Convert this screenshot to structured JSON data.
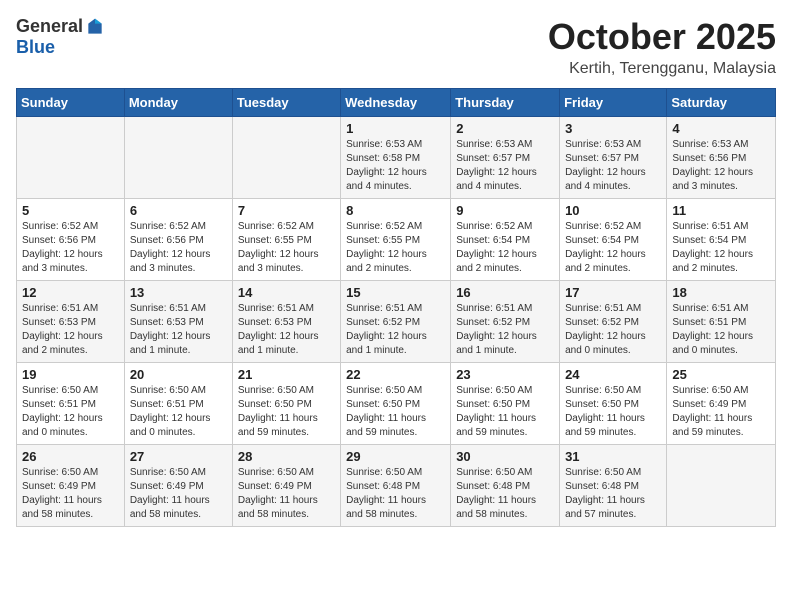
{
  "header": {
    "logo_general": "General",
    "logo_blue": "Blue",
    "month_title": "October 2025",
    "subtitle": "Kertih, Terengganu, Malaysia"
  },
  "days_of_week": [
    "Sunday",
    "Monday",
    "Tuesday",
    "Wednesday",
    "Thursday",
    "Friday",
    "Saturday"
  ],
  "weeks": [
    [
      {
        "day": "",
        "info": ""
      },
      {
        "day": "",
        "info": ""
      },
      {
        "day": "",
        "info": ""
      },
      {
        "day": "1",
        "info": "Sunrise: 6:53 AM\nSunset: 6:58 PM\nDaylight: 12 hours\nand 4 minutes."
      },
      {
        "day": "2",
        "info": "Sunrise: 6:53 AM\nSunset: 6:57 PM\nDaylight: 12 hours\nand 4 minutes."
      },
      {
        "day": "3",
        "info": "Sunrise: 6:53 AM\nSunset: 6:57 PM\nDaylight: 12 hours\nand 4 minutes."
      },
      {
        "day": "4",
        "info": "Sunrise: 6:53 AM\nSunset: 6:56 PM\nDaylight: 12 hours\nand 3 minutes."
      }
    ],
    [
      {
        "day": "5",
        "info": "Sunrise: 6:52 AM\nSunset: 6:56 PM\nDaylight: 12 hours\nand 3 minutes."
      },
      {
        "day": "6",
        "info": "Sunrise: 6:52 AM\nSunset: 6:56 PM\nDaylight: 12 hours\nand 3 minutes."
      },
      {
        "day": "7",
        "info": "Sunrise: 6:52 AM\nSunset: 6:55 PM\nDaylight: 12 hours\nand 3 minutes."
      },
      {
        "day": "8",
        "info": "Sunrise: 6:52 AM\nSunset: 6:55 PM\nDaylight: 12 hours\nand 2 minutes."
      },
      {
        "day": "9",
        "info": "Sunrise: 6:52 AM\nSunset: 6:54 PM\nDaylight: 12 hours\nand 2 minutes."
      },
      {
        "day": "10",
        "info": "Sunrise: 6:52 AM\nSunset: 6:54 PM\nDaylight: 12 hours\nand 2 minutes."
      },
      {
        "day": "11",
        "info": "Sunrise: 6:51 AM\nSunset: 6:54 PM\nDaylight: 12 hours\nand 2 minutes."
      }
    ],
    [
      {
        "day": "12",
        "info": "Sunrise: 6:51 AM\nSunset: 6:53 PM\nDaylight: 12 hours\nand 2 minutes."
      },
      {
        "day": "13",
        "info": "Sunrise: 6:51 AM\nSunset: 6:53 PM\nDaylight: 12 hours\nand 1 minute."
      },
      {
        "day": "14",
        "info": "Sunrise: 6:51 AM\nSunset: 6:53 PM\nDaylight: 12 hours\nand 1 minute."
      },
      {
        "day": "15",
        "info": "Sunrise: 6:51 AM\nSunset: 6:52 PM\nDaylight: 12 hours\nand 1 minute."
      },
      {
        "day": "16",
        "info": "Sunrise: 6:51 AM\nSunset: 6:52 PM\nDaylight: 12 hours\nand 1 minute."
      },
      {
        "day": "17",
        "info": "Sunrise: 6:51 AM\nSunset: 6:52 PM\nDaylight: 12 hours\nand 0 minutes."
      },
      {
        "day": "18",
        "info": "Sunrise: 6:51 AM\nSunset: 6:51 PM\nDaylight: 12 hours\nand 0 minutes."
      }
    ],
    [
      {
        "day": "19",
        "info": "Sunrise: 6:50 AM\nSunset: 6:51 PM\nDaylight: 12 hours\nand 0 minutes."
      },
      {
        "day": "20",
        "info": "Sunrise: 6:50 AM\nSunset: 6:51 PM\nDaylight: 12 hours\nand 0 minutes."
      },
      {
        "day": "21",
        "info": "Sunrise: 6:50 AM\nSunset: 6:50 PM\nDaylight: 11 hours\nand 59 minutes."
      },
      {
        "day": "22",
        "info": "Sunrise: 6:50 AM\nSunset: 6:50 PM\nDaylight: 11 hours\nand 59 minutes."
      },
      {
        "day": "23",
        "info": "Sunrise: 6:50 AM\nSunset: 6:50 PM\nDaylight: 11 hours\nand 59 minutes."
      },
      {
        "day": "24",
        "info": "Sunrise: 6:50 AM\nSunset: 6:50 PM\nDaylight: 11 hours\nand 59 minutes."
      },
      {
        "day": "25",
        "info": "Sunrise: 6:50 AM\nSunset: 6:49 PM\nDaylight: 11 hours\nand 59 minutes."
      }
    ],
    [
      {
        "day": "26",
        "info": "Sunrise: 6:50 AM\nSunset: 6:49 PM\nDaylight: 11 hours\nand 58 minutes."
      },
      {
        "day": "27",
        "info": "Sunrise: 6:50 AM\nSunset: 6:49 PM\nDaylight: 11 hours\nand 58 minutes."
      },
      {
        "day": "28",
        "info": "Sunrise: 6:50 AM\nSunset: 6:49 PM\nDaylight: 11 hours\nand 58 minutes."
      },
      {
        "day": "29",
        "info": "Sunrise: 6:50 AM\nSunset: 6:48 PM\nDaylight: 11 hours\nand 58 minutes."
      },
      {
        "day": "30",
        "info": "Sunrise: 6:50 AM\nSunset: 6:48 PM\nDaylight: 11 hours\nand 58 minutes."
      },
      {
        "day": "31",
        "info": "Sunrise: 6:50 AM\nSunset: 6:48 PM\nDaylight: 11 hours\nand 57 minutes."
      },
      {
        "day": "",
        "info": ""
      }
    ]
  ]
}
